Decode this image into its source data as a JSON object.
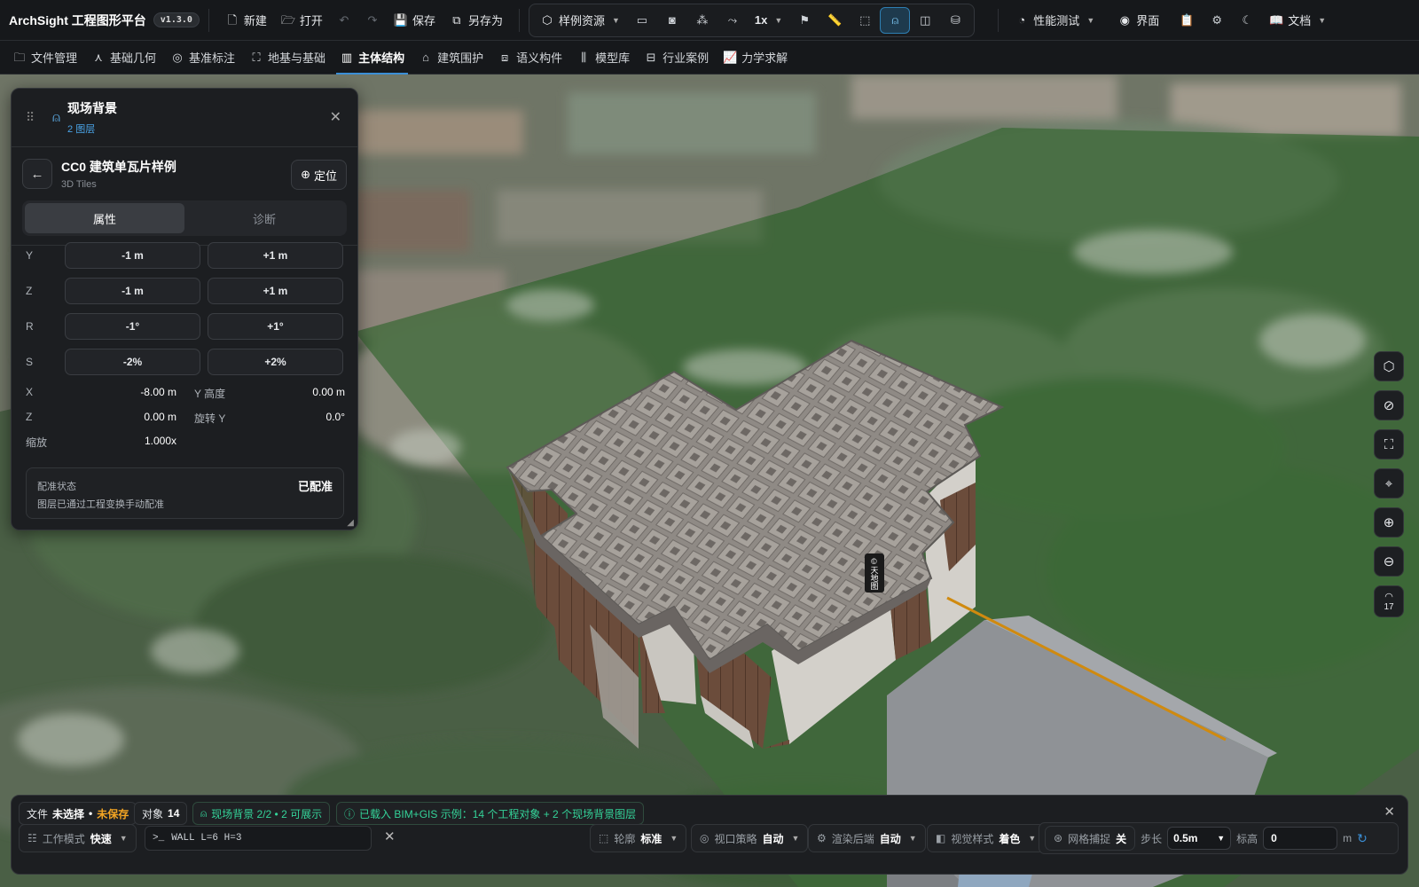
{
  "app": {
    "name": "ArchSight 工程图形平台",
    "version": "v1.3.0"
  },
  "toolbar": {
    "new": "新建",
    "open": "打开",
    "save": "保存",
    "save_as": "另存为",
    "sample_resources": "样例资源",
    "speed": "1x",
    "perf": "性能测试",
    "ui": "界面",
    "docs": "文档"
  },
  "nav": {
    "tabs": [
      {
        "label": "文件管理",
        "icon": "folder-icon"
      },
      {
        "label": "基础几何",
        "icon": "geometry-icon"
      },
      {
        "label": "基准标注",
        "icon": "target-icon"
      },
      {
        "label": "地基与基础",
        "icon": "foundation-icon"
      },
      {
        "label": "主体结构",
        "icon": "columns-icon",
        "active": true
      },
      {
        "label": "建筑围护",
        "icon": "house-icon"
      },
      {
        "label": "语义构件",
        "icon": "component-icon"
      },
      {
        "label": "模型库",
        "icon": "library-icon"
      },
      {
        "label": "行业案例",
        "icon": "briefcase-icon"
      },
      {
        "label": "力学求解",
        "icon": "chart-icon"
      }
    ]
  },
  "panel": {
    "title": "现场背景",
    "subtitle": "2 图层",
    "item_title": "CC0 建筑单瓦片样例",
    "item_type": "3D Tiles",
    "locate": "定位",
    "tabs": [
      "属性",
      "诊断"
    ],
    "steppers": [
      {
        "axis": "Y",
        "minus": "-1 m",
        "plus": "+1 m"
      },
      {
        "axis": "Z",
        "minus": "-1 m",
        "plus": "+1 m"
      },
      {
        "axis": "R",
        "minus": "-1°",
        "plus": "+1°"
      },
      {
        "axis": "S",
        "minus": "-2%",
        "plus": "+2%"
      }
    ],
    "values": {
      "x_label": "X",
      "x_value": "-8.00 m",
      "yh_label": "Y 高度",
      "yh_value": "0.00 m",
      "z_label": "Z",
      "z_value": "0.00 m",
      "rot_label": "旋转 Y",
      "rot_value": "0.0°",
      "scale_label": "缩放",
      "scale_value": "1.000x"
    },
    "status": {
      "label": "配准状态",
      "value": "已配准",
      "desc": "图层已通过工程变换手动配准"
    }
  },
  "map": {
    "attribution": "©天地图"
  },
  "right_tools": {
    "zoom_level": "17"
  },
  "bottom": {
    "file_label": "文件",
    "file_state": "未选择",
    "file_unsaved": "未保存",
    "obj_label": "对象",
    "obj_count": "14",
    "bg_status": "现场背景 2/2 • 2 可展示",
    "load_msg": "已载入 BIM+GIS 示例：14 个工程对象 + 2 个现场背景图层",
    "work_mode_label": "工作模式",
    "work_mode": "快速",
    "command": "WALL L=6 H=3",
    "outline_label": "轮廓",
    "outline": "标准",
    "view_strategy_label": "视口策略",
    "view_strategy": "自动",
    "render_post_label": "渲染后端",
    "render_post": "自动",
    "visual_style_label": "视觉样式",
    "visual_style": "着色",
    "grid_snap_label": "网格捕捉",
    "grid_snap": "关",
    "step_label": "步长",
    "step": "0.5m",
    "elev_label": "标高",
    "elev": "0",
    "elev_unit": "m"
  }
}
